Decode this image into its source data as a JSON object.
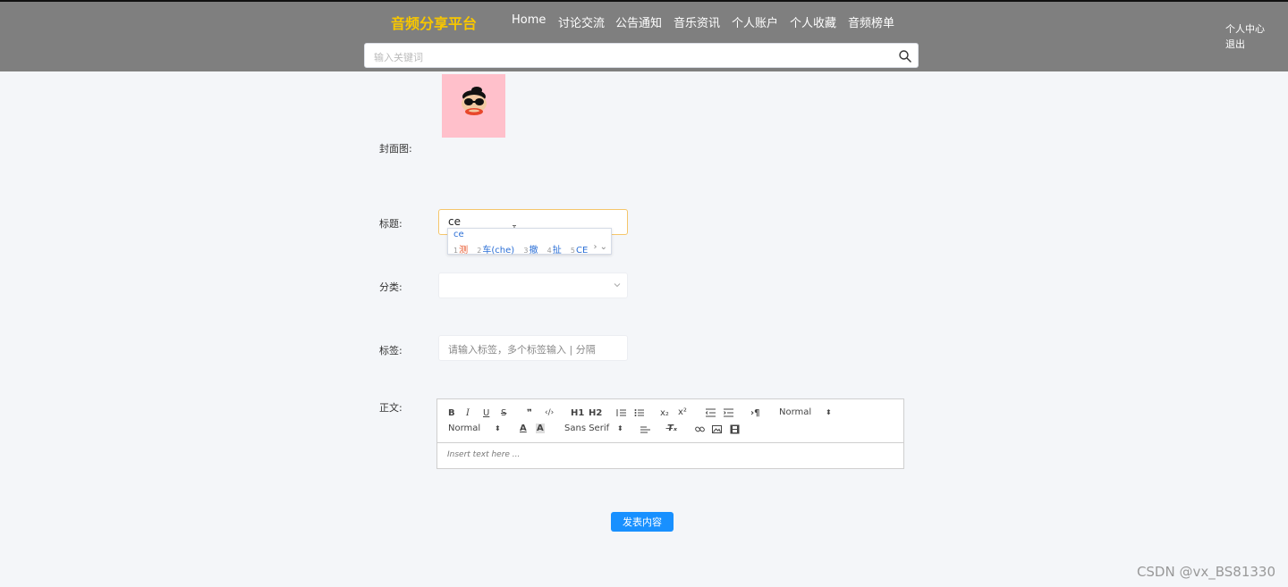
{
  "header": {
    "brand": "音频分享平台",
    "nav": [
      "Home",
      "讨论交流",
      "公告通知",
      "音乐资讯",
      "个人账户",
      "个人收藏",
      "音频榜单"
    ],
    "user_center": "个人中心",
    "logout": "退出",
    "search_placeholder": "输入关键词",
    "search_icon": "search-icon"
  },
  "form": {
    "cover_label": "封面图:",
    "title_label": "标题:",
    "title_value": "ce",
    "category_label": "分类:",
    "category_value": "",
    "tags_label": "标签:",
    "tags_placeholder": "请输入标签，多个标签输入 | 分隔",
    "body_label": "正文:",
    "submit_label": "发表内容"
  },
  "ime": {
    "pinyin": "ce",
    "candidates": [
      {
        "num": "1",
        "text": "测"
      },
      {
        "num": "2",
        "text": "车(che)"
      },
      {
        "num": "3",
        "text": "撤"
      },
      {
        "num": "4",
        "text": "扯"
      },
      {
        "num": "5",
        "text": "CE"
      }
    ],
    "arrows": "› ⌄"
  },
  "editor": {
    "h1": "H1",
    "h2": "H2",
    "sub": "x₂",
    "sup": "x²",
    "size_select": "Normal",
    "header_select": "Normal",
    "font_select": "Sans Serif",
    "placeholder": "Insert text here ..."
  },
  "watermark": "CSDN @vx_BS81330",
  "colors": {
    "topbar": "#7f7f7f",
    "brand": "#f7c600",
    "primary_button": "#1890ff",
    "cover_background": "#ffc0cb",
    "focus_border": "#f5c66b"
  }
}
